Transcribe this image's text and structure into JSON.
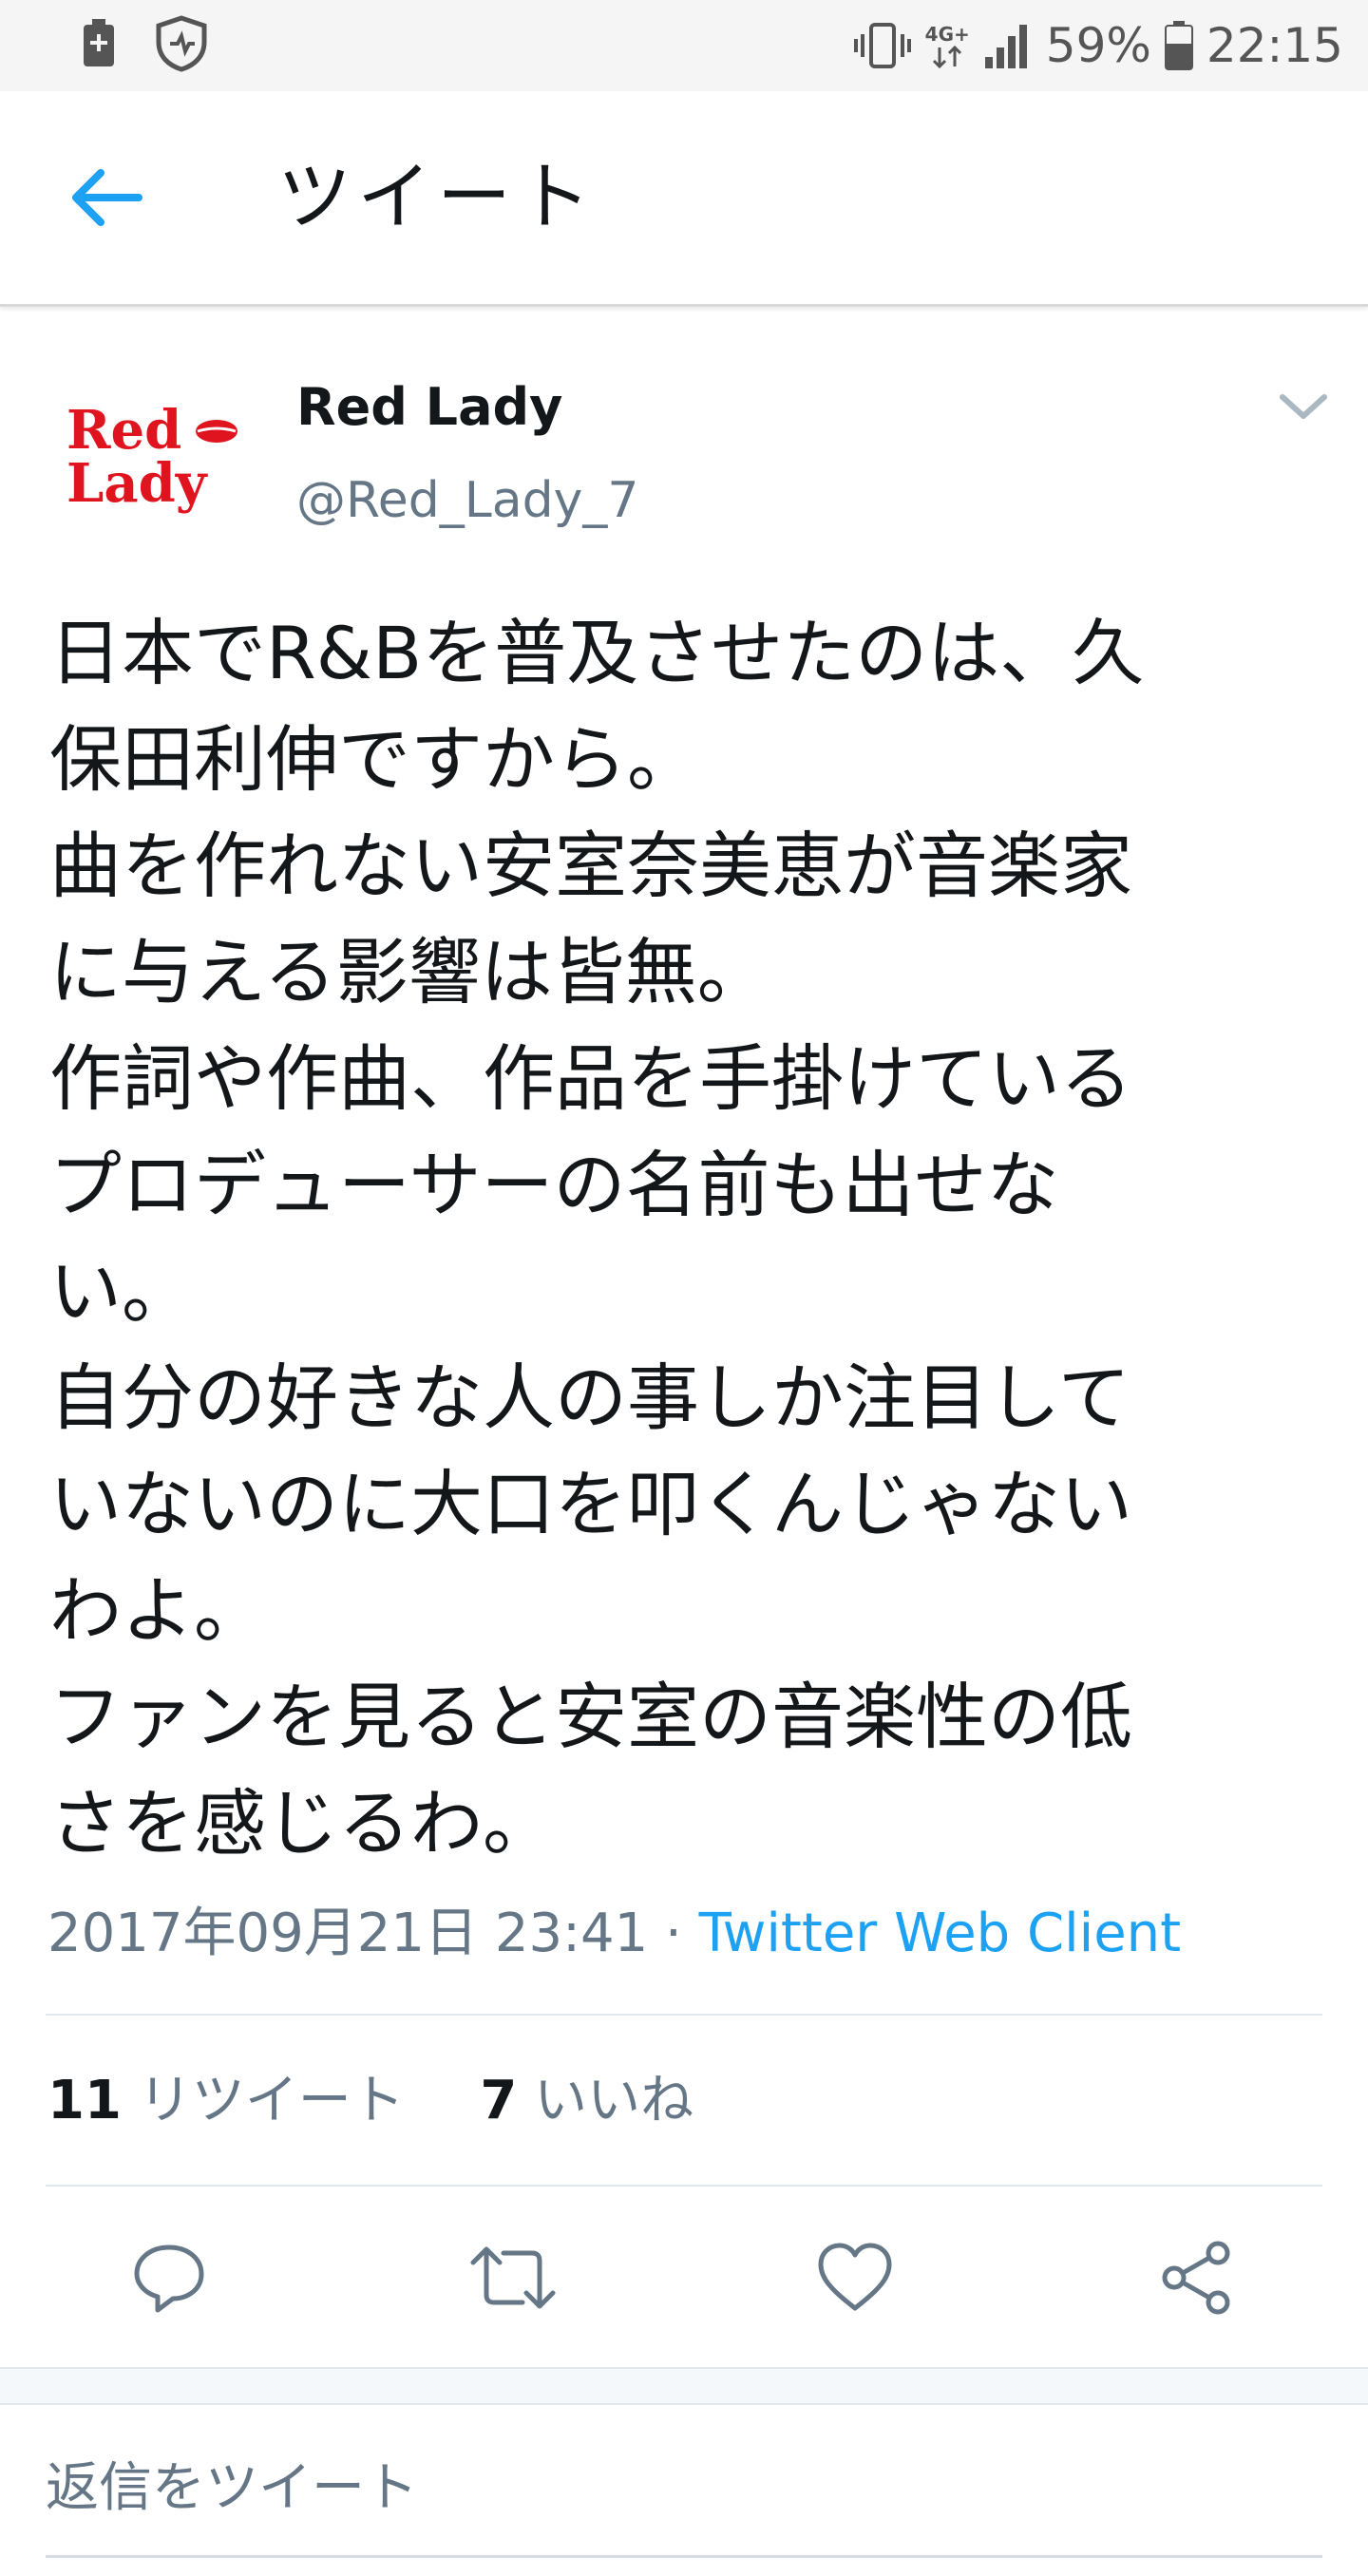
{
  "status_bar": {
    "battery_percent": "59%",
    "time": "22:15",
    "network": "4G+"
  },
  "header": {
    "title": "ツイート"
  },
  "tweet": {
    "avatar_text_line1": "Red",
    "avatar_text_line2": "Lady",
    "author_name": "Red Lady",
    "author_handle": "@Red_Lady_7",
    "text_lines": [
      "日本でR&Bを普及させたのは、久",
      "保田利伸ですから。",
      "曲を作れない安室奈美恵が音楽家",
      "に与える影響は皆無。",
      "作詞や作曲、作品を手掛けている",
      "プロデューサーの名前も出せな",
      "い。",
      "自分の好きな人の事しか注目して",
      "いないのに大口を叩くんじゃない",
      "わよ。",
      "ファンを見ると安室の音楽性の低",
      "さを感じるわ。"
    ],
    "timestamp": "2017年09月21日 23:41",
    "separator": " · ",
    "client": "Twitter Web Client",
    "retweet_count": "11",
    "retweet_label": "リツイート",
    "like_count": "7",
    "like_label": "いいね"
  },
  "actions": {
    "icons": [
      "reply-icon",
      "retweet-icon",
      "like-icon",
      "share-icon"
    ]
  },
  "reply": {
    "placeholder": "返信をツイート"
  },
  "colors": {
    "accent": "#1da1f2",
    "secondary_text": "#657786",
    "primary_text": "#14171a",
    "brand_red": "#e0141e"
  }
}
